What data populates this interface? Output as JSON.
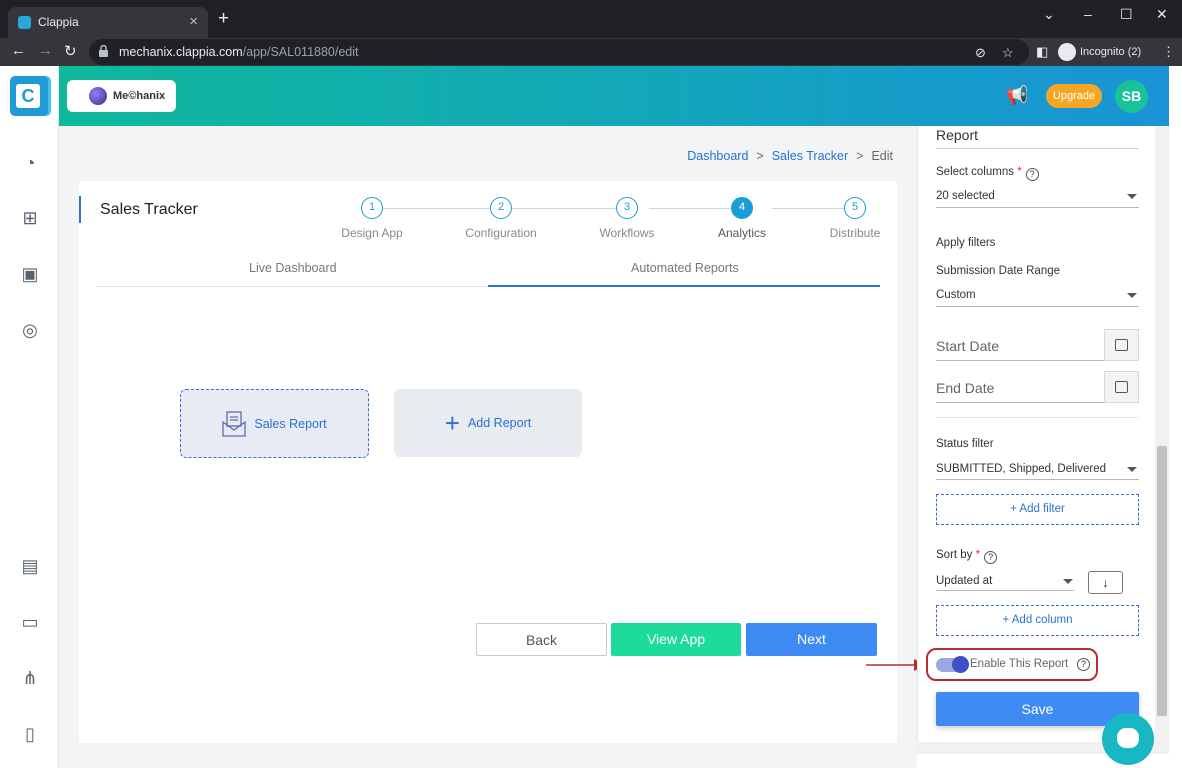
{
  "browser": {
    "tab_title": "Clappia",
    "url_domain": "mechanix.clappia.com",
    "url_path": "/app/SAL011880/edit",
    "incognito_label": "Incognito (2)"
  },
  "header": {
    "workspace": "Me©hanix",
    "upgrade": "Upgrade",
    "avatar": "SB"
  },
  "breadcrumb": {
    "dashboard": "Dashboard",
    "sales_tracker": "Sales Tracker",
    "edit": "Edit",
    "sep": ">"
  },
  "card": {
    "title": "Sales Tracker",
    "steps": [
      {
        "num": "1",
        "label": "Design App"
      },
      {
        "num": "2",
        "label": "Configuration"
      },
      {
        "num": "3",
        "label": "Workflows"
      },
      {
        "num": "4",
        "label": "Analytics"
      },
      {
        "num": "5",
        "label": "Distribute"
      }
    ],
    "subtabs": [
      "Live Dashboard",
      "Automated Reports"
    ],
    "reports": {
      "sales_report": "Sales Report",
      "add_report": "Add Report"
    },
    "buttons": {
      "back": "Back",
      "view_app": "View App",
      "next": "Next"
    }
  },
  "panel": {
    "title": "Report",
    "select_columns_label": "Select columns",
    "required": "*",
    "help": "?",
    "select_columns_value": "20 selected",
    "apply_filters": "Apply filters",
    "date_range_label": "Submission Date Range",
    "date_range_value": "Custom",
    "start_date": "Start Date",
    "end_date": "End Date",
    "status_filter_label": "Status filter",
    "status_filter_value": "SUBMITTED, Shipped, Delivered",
    "add_filter": "+ Add filter",
    "sort_by_label": "Sort by",
    "sort_by_value": "Updated at",
    "sort_dir": "↓",
    "add_column": "+ Add column",
    "enable_report": "Enable This Report",
    "save": "Save"
  },
  "colors": {
    "accent": "#3f8bf4",
    "view_app": "#1ddb9b",
    "upgrade": "#f5a623",
    "avatar": "#19c39a"
  }
}
